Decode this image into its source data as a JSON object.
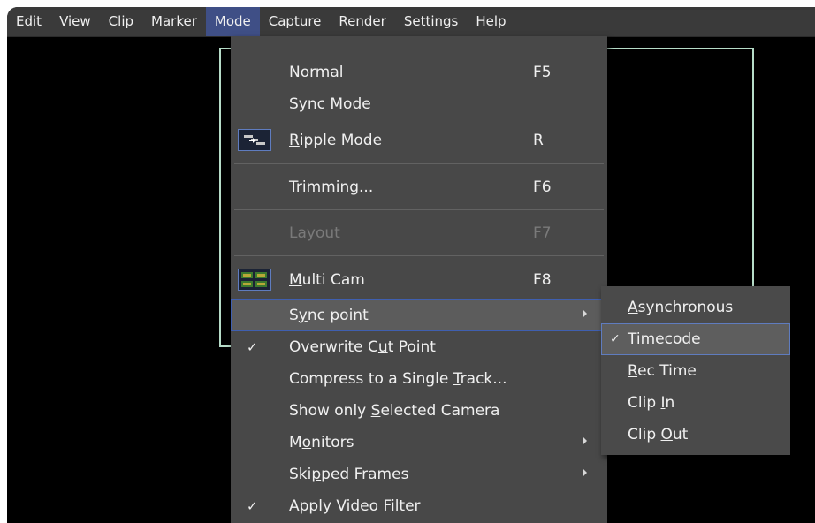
{
  "menubar": {
    "items": [
      {
        "label": "Edit"
      },
      {
        "label": "View"
      },
      {
        "label": "Clip"
      },
      {
        "label": "Marker"
      },
      {
        "label": "Mode"
      },
      {
        "label": "Capture"
      },
      {
        "label": "Render"
      },
      {
        "label": "Settings"
      },
      {
        "label": "Help"
      }
    ],
    "active_item": "Mode"
  },
  "mode_menu": {
    "items": [
      {
        "label": "Normal",
        "shortcut": "F5"
      },
      {
        "label": "Sync Mode"
      },
      {
        "label": "Ripple Mode",
        "shortcut": "R",
        "icon": "ripple-mode-icon"
      },
      {
        "label": "Trimming...",
        "shortcut": "F6"
      },
      {
        "label": "Layout",
        "shortcut": "F7",
        "disabled": true
      },
      {
        "label": "Multi Cam",
        "shortcut": "F8",
        "icon": "multi-cam-icon"
      },
      {
        "label": "Sync point",
        "submenu": true,
        "highlighted": true
      },
      {
        "label": "Overwrite Cut Point",
        "checked": true
      },
      {
        "label": "Compress to a Single Track..."
      },
      {
        "label": "Show only Selected Camera"
      },
      {
        "label": "Monitors",
        "submenu": true
      },
      {
        "label": "Skipped Frames",
        "submenu": true
      },
      {
        "label": "Apply Video Filter",
        "checked": true
      }
    ],
    "check_glyph": "✓"
  },
  "sync_point_submenu": {
    "items": [
      {
        "label": "Asynchronous"
      },
      {
        "label": "Timecode",
        "checked": true,
        "highlighted": true
      },
      {
        "label": "Rec Time"
      },
      {
        "label": "Clip In"
      },
      {
        "label": "Clip Out"
      }
    ]
  },
  "colors": {
    "menubar_bg": "#3a3a3a",
    "menu_bg": "#484848",
    "highlight_border": "#3f5fb0",
    "active_menubar": "#3f4f86",
    "monitor_frame": "#b6dcc8"
  }
}
